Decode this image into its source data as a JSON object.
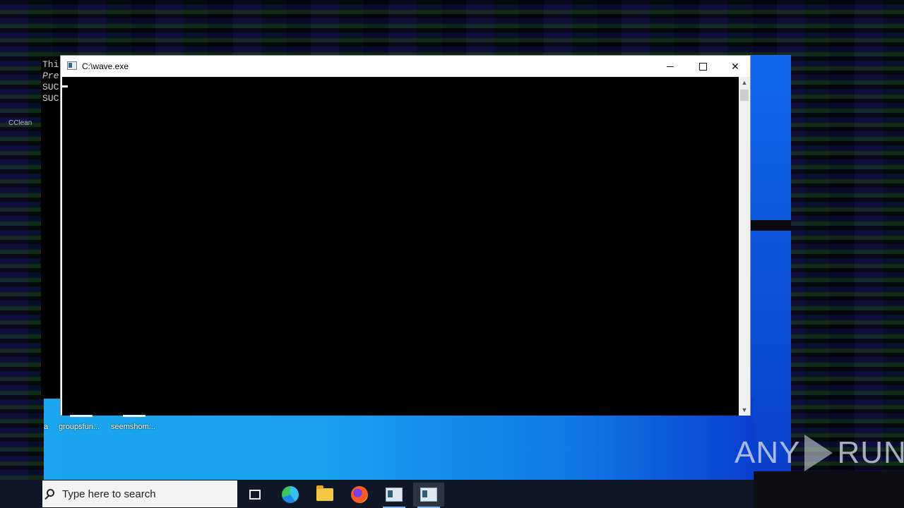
{
  "console_behind": {
    "lines": [
      "Thi",
      "Pre",
      "SUC",
      "SUC"
    ]
  },
  "desktop": {
    "ccleaner_label": "CClean",
    "icons": [
      {
        "label": "a"
      },
      {
        "label": "groupsfun..."
      },
      {
        "label": "seemshom..."
      }
    ]
  },
  "window": {
    "title": "C:\\wave.exe",
    "minimize_glyph": "—",
    "close_glyph": "✕",
    "scroll_up_glyph": "▲",
    "scroll_down_glyph": "▼"
  },
  "taskbar": {
    "search_placeholder": "Type here to search",
    "icons": [
      "task-view-icon",
      "edge-icon",
      "file-explorer-icon",
      "firefox-icon",
      "console-app-icon",
      "console-app-active-icon"
    ]
  },
  "watermark": {
    "left": "ANY",
    "right": "RUN"
  },
  "colors": {
    "desktop_blue": "#1aa7ee",
    "taskbar": "#101827",
    "console_bg": "#000000"
  }
}
